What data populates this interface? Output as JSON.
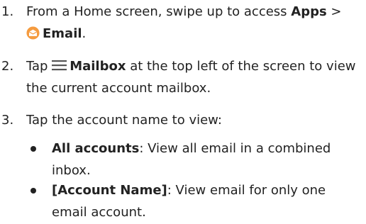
{
  "steps": [
    {
      "number": "1.",
      "prefix": "From a Home screen, swipe up to access ",
      "apps": "Apps",
      "separator": " >",
      "email": "Email",
      "suffix": "."
    },
    {
      "number": "2.",
      "prefix": "Tap ",
      "mailbox": "Mailbox",
      "suffix": " at the top left of the screen to view the current account mailbox."
    },
    {
      "number": "3.",
      "text": "Tap the account name to view:"
    }
  ],
  "bullets": [
    {
      "label": "All accounts",
      "text": ": View all email in a combined inbox."
    },
    {
      "label": "[Account Name]",
      "text": ": View email for only one email account."
    }
  ],
  "colors": {
    "email_icon": "#f59b3f",
    "email_icon_envelope": "#ffffff"
  },
  "icons": {
    "email": "email-app-icon",
    "mailbox": "hamburger-menu-icon"
  }
}
